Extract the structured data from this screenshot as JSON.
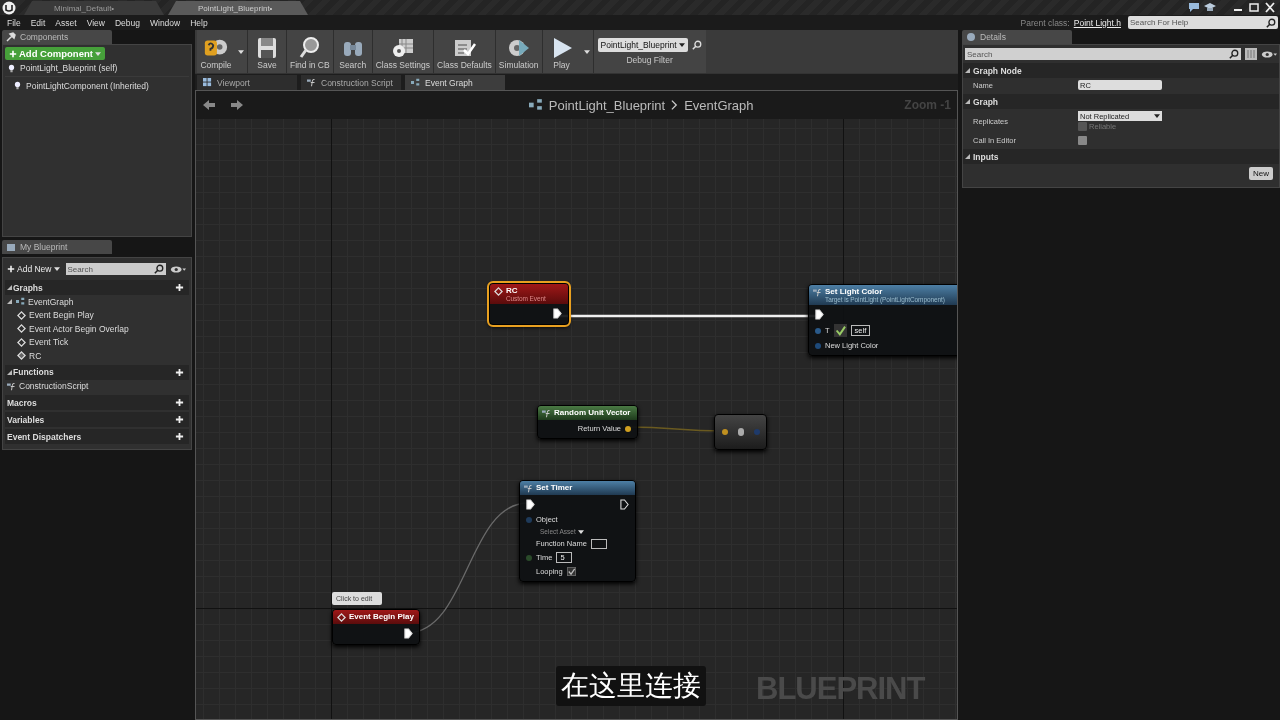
{
  "title_bar": {
    "tabs": [
      {
        "label": "Minimal_Default•",
        "selected": false
      },
      {
        "label": "PointLight_Blueprint•",
        "selected": true
      }
    ]
  },
  "menu": [
    "File",
    "Edit",
    "Asset",
    "View",
    "Debug",
    "Window",
    "Help"
  ],
  "help_bar": {
    "parent_class_label": "Parent class:",
    "parent_class": "Point Light.h",
    "search_placeholder": "Search For Help"
  },
  "components": {
    "title": "Components",
    "add_button": "Add Component",
    "tree": [
      {
        "label": "PointLight_Blueprint (self)",
        "children": [
          {
            "label": "PointLightComponent (Inherited)"
          }
        ]
      }
    ]
  },
  "my_blueprint": {
    "title": "My Blueprint",
    "add_button": "Add New",
    "search_placeholder": "Search",
    "sections": [
      {
        "title": "Graphs",
        "items": [
          {
            "label": "EventGraph",
            "kind": "graph",
            "children": [
              {
                "label": "Event Begin Play",
                "kind": "event"
              },
              {
                "label": "Event Actor Begin Overlap",
                "kind": "event"
              },
              {
                "label": "Event Tick",
                "kind": "event"
              },
              {
                "label": "RC",
                "kind": "custom_event"
              }
            ]
          }
        ]
      },
      {
        "title": "Functions",
        "items": [
          {
            "label": "ConstructionScript",
            "kind": "function"
          }
        ]
      },
      {
        "title": "Macros"
      },
      {
        "title": "Variables"
      },
      {
        "title": "Event Dispatchers"
      }
    ]
  },
  "toolbar": {
    "buttons": [
      {
        "label": "Compile",
        "kind": "compile",
        "dropdown": true
      },
      {
        "label": "Save",
        "kind": "save",
        "dropdown": false
      },
      {
        "label": "Find in CB",
        "kind": "find",
        "dropdown": false
      },
      {
        "label": "Search",
        "kind": "search",
        "dropdown": false
      },
      {
        "label": "Class Settings",
        "kind": "settings",
        "dropdown": false
      },
      {
        "label": "Class Defaults",
        "kind": "defaults",
        "dropdown": false
      },
      {
        "label": "Simulation",
        "kind": "simulation",
        "dropdown": false
      },
      {
        "label": "Play",
        "kind": "play",
        "dropdown": true
      }
    ],
    "debug_filter": {
      "value": "PointLight_Blueprint",
      "label": "Debug Filter"
    }
  },
  "editor_tabs": [
    {
      "label": "Viewport",
      "kind": "viewport",
      "selected": false
    },
    {
      "label": "Construction Script",
      "kind": "function",
      "selected": false
    },
    {
      "label": "Event Graph",
      "kind": "graph",
      "selected": true
    }
  ],
  "graph": {
    "breadcrumb": [
      "PointLight_Blueprint",
      "EventGraph"
    ],
    "zoom": "Zoom -1",
    "watermark": "BLUEPRINT",
    "caption": "在这里连接",
    "nodes": [
      {
        "kind": "event",
        "title": "RC",
        "subtitle": "Custom Event",
        "selected": true,
        "exec_pins": [
          {
            "kind": "output",
            "connected": true
          }
        ]
      },
      {
        "kind": "function",
        "title": "Set Light Color",
        "subtitle": "Target is PointLight (PointLightComponent)",
        "selected": false,
        "exec_pins": [
          {
            "kind": "input",
            "connected": true
          }
        ],
        "pins": [
          {
            "kind": "target",
            "label": "T",
            "value": "self"
          },
          {
            "kind": "data_in",
            "label": "New Light Color"
          }
        ]
      },
      {
        "kind": "pure",
        "title": "Random Unit Vector",
        "selected": false,
        "pins": [
          {
            "kind": "data_out",
            "label": "Return Value"
          }
        ]
      },
      {
        "kind": "compact",
        "selected": false
      },
      {
        "kind": "function",
        "title": "Set Timer",
        "selected": false,
        "exec_pins": [
          {
            "kind": "input",
            "connected": true
          },
          {
            "kind": "output",
            "connected": false
          }
        ],
        "pins": [
          {
            "kind": "object",
            "label": "Object",
            "value": "Select Asset"
          },
          {
            "kind": "text_box",
            "label": "Function Name"
          },
          {
            "kind": "number",
            "label": "Time",
            "value": "5"
          },
          {
            "kind": "check",
            "label": "Looping",
            "checked": true
          }
        ]
      },
      {
        "kind": "event",
        "title": "Event Begin Play",
        "comment": "Click to edit",
        "selected": false,
        "exec_pins": [
          {
            "kind": "output",
            "connected": true
          }
        ]
      }
    ]
  },
  "details": {
    "title": "Details",
    "search_placeholder": "Search",
    "sections": [
      {
        "title": "Graph Node",
        "rows": [
          {
            "kind": "text",
            "label": "Name",
            "value": "RC"
          }
        ]
      },
      {
        "title": "Graph",
        "rows": [
          {
            "kind": "dropdown",
            "label": "Replicates",
            "value": "Not Replicated",
            "option": {
              "label": "Reliable",
              "checked": false,
              "disabled": true
            }
          },
          {
            "kind": "check",
            "label": "Call In Editor",
            "checked": false
          }
        ]
      },
      {
        "title": "Inputs",
        "button": "New"
      }
    ]
  }
}
